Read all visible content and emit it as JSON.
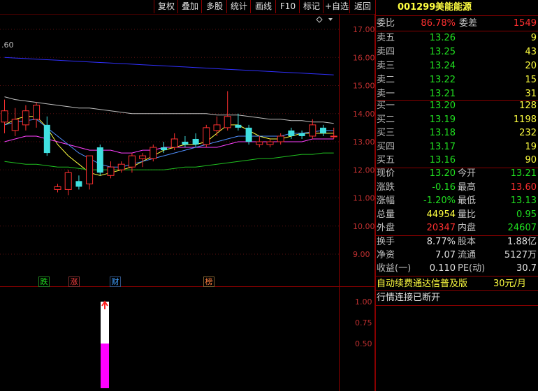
{
  "toolbar": {
    "buttons": [
      "复权",
      "叠加",
      "多股",
      "统计",
      "画线",
      "F10",
      "标记",
      "+自选",
      "返回"
    ]
  },
  "chart": {
    "price_axis": [
      "17.00",
      "16.00",
      "15.00",
      "14.00",
      "13.00",
      "12.00",
      "11.00",
      "10.00",
      "9.00"
    ],
    "indicator_axis": [
      "1.00",
      "0.75",
      "0.50"
    ],
    "left_label": ".60",
    "events": [
      "跌",
      "涨",
      "财",
      "榜"
    ],
    "indicator_value": 0.5
  },
  "chart_data": {
    "type": "candlestick",
    "ylim": [
      8.6,
      17.4
    ],
    "candles": [
      {
        "o": 13.7,
        "h": 14.5,
        "l": 13.3,
        "c": 14.1
      },
      {
        "o": 13.4,
        "h": 14.2,
        "l": 13.2,
        "c": 13.8
      },
      {
        "o": 13.6,
        "h": 14.3,
        "l": 13.4,
        "c": 14.1
      },
      {
        "o": 13.8,
        "h": 14.4,
        "l": 13.5,
        "c": 14.3
      },
      {
        "o": 13.6,
        "h": 13.9,
        "l": 12.5,
        "c": 12.6
      },
      {
        "o": 11.3,
        "h": 11.5,
        "l": 11.2,
        "c": 11.4
      },
      {
        "o": 11.3,
        "h": 12.0,
        "l": 11.1,
        "c": 11.9
      },
      {
        "o": 11.6,
        "h": 11.8,
        "l": 11.3,
        "c": 11.4
      },
      {
        "o": 11.5,
        "h": 12.5,
        "l": 11.3,
        "c": 12.5
      },
      {
        "o": 12.8,
        "h": 12.9,
        "l": 11.8,
        "c": 11.9
      },
      {
        "o": 11.8,
        "h": 12.3,
        "l": 11.7,
        "c": 12.1
      },
      {
        "o": 12.0,
        "h": 12.3,
        "l": 11.9,
        "c": 12.2
      },
      {
        "o": 12.1,
        "h": 12.6,
        "l": 11.9,
        "c": 12.5
      },
      {
        "o": 12.4,
        "h": 12.6,
        "l": 12.1,
        "c": 12.5
      },
      {
        "o": 12.4,
        "h": 12.9,
        "l": 12.3,
        "c": 12.8
      },
      {
        "o": 12.8,
        "h": 13.0,
        "l": 12.6,
        "c": 12.7
      },
      {
        "o": 12.8,
        "h": 13.3,
        "l": 12.7,
        "c": 13.1
      },
      {
        "o": 13.0,
        "h": 13.2,
        "l": 12.8,
        "c": 12.9
      },
      {
        "o": 13.1,
        "h": 13.3,
        "l": 12.8,
        "c": 12.9
      },
      {
        "o": 12.9,
        "h": 13.6,
        "l": 12.8,
        "c": 13.5
      },
      {
        "o": 13.4,
        "h": 13.9,
        "l": 13.2,
        "c": 13.6
      },
      {
        "o": 13.5,
        "h": 14.8,
        "l": 13.4,
        "c": 13.9
      },
      {
        "o": 13.6,
        "h": 14.0,
        "l": 13.4,
        "c": 13.5
      },
      {
        "o": 13.5,
        "h": 13.6,
        "l": 12.9,
        "c": 13.0
      },
      {
        "o": 12.9,
        "h": 13.2,
        "l": 12.8,
        "c": 13.0
      },
      {
        "o": 12.9,
        "h": 13.1,
        "l": 12.8,
        "c": 13.0
      },
      {
        "o": 13.0,
        "h": 13.3,
        "l": 12.9,
        "c": 13.2
      },
      {
        "o": 13.4,
        "h": 13.5,
        "l": 13.1,
        "c": 13.2
      },
      {
        "o": 13.3,
        "h": 13.4,
        "l": 13.1,
        "c": 13.2
      },
      {
        "o": 13.2,
        "h": 13.8,
        "l": 13.1,
        "c": 13.6
      },
      {
        "o": 13.5,
        "h": 13.6,
        "l": 13.2,
        "c": 13.3
      },
      {
        "o": 13.2,
        "h": 13.5,
        "l": 13.1,
        "c": 13.2
      }
    ],
    "ma_series": [
      {
        "color": "#3030ff",
        "values": [
          16.0,
          15.98,
          15.96,
          15.94,
          15.92,
          15.9,
          15.88,
          15.86,
          15.84,
          15.82,
          15.8,
          15.78,
          15.76,
          15.74,
          15.72,
          15.7,
          15.68,
          15.66,
          15.64,
          15.62,
          15.6,
          15.58,
          15.56,
          15.54,
          15.52,
          15.5,
          15.48,
          15.46,
          15.44,
          15.42,
          15.4,
          15.38
        ]
      },
      {
        "color": "#c0c0c0",
        "values": [
          14.6,
          14.5,
          14.45,
          14.4,
          14.35,
          14.3,
          14.25,
          14.2,
          14.2,
          14.15,
          14.1,
          14.05,
          14.0,
          14.0,
          14.0,
          14.0,
          14.0,
          14.0,
          14.0,
          14.0,
          13.95,
          13.95,
          13.95,
          13.9,
          13.85,
          13.8,
          13.8,
          13.75,
          13.75,
          13.7,
          13.7,
          13.65
        ]
      },
      {
        "color": "#ffff40",
        "values": [
          13.6,
          13.8,
          13.9,
          13.9,
          13.5,
          12.9,
          12.5,
          12.2,
          11.9,
          11.8,
          11.9,
          12.0,
          12.1,
          12.3,
          12.5,
          12.7,
          12.8,
          12.9,
          12.9,
          13.0,
          13.3,
          13.6,
          13.6,
          13.4,
          13.2,
          13.1,
          13.1,
          13.2,
          13.3,
          13.3,
          13.3,
          13.3
        ]
      },
      {
        "color": "#ff40ff",
        "values": [
          13.0,
          13.1,
          13.2,
          13.2,
          13.1,
          13.0,
          12.9,
          12.8,
          12.7,
          12.7,
          12.7,
          12.6,
          12.6,
          12.7,
          12.7,
          12.8,
          12.8,
          12.8,
          12.8,
          12.8,
          12.8,
          12.9,
          13.0,
          13.0,
          13.0,
          13.0,
          13.0,
          13.0,
          13.0,
          13.1,
          13.1,
          13.1
        ]
      },
      {
        "color": "#20c020",
        "values": [
          12.3,
          12.25,
          12.2,
          12.2,
          12.15,
          12.1,
          12.1,
          12.05,
          12.0,
          12.0,
          12.0,
          12.0,
          12.0,
          12.0,
          12.0,
          12.0,
          12.05,
          12.1,
          12.1,
          12.15,
          12.2,
          12.25,
          12.3,
          12.35,
          12.4,
          12.4,
          12.45,
          12.5,
          12.55,
          12.55,
          12.6,
          12.6
        ]
      },
      {
        "color": "#5090ff",
        "values": [
          13.6,
          13.7,
          13.75,
          13.8,
          13.5,
          13.2,
          12.9,
          12.6,
          12.4,
          12.2,
          12.1,
          12.1,
          12.2,
          12.3,
          12.4,
          12.5,
          12.6,
          12.7,
          12.8,
          12.9,
          13.0,
          13.1,
          13.2,
          13.2,
          13.2,
          13.2,
          13.2,
          13.3,
          13.3,
          13.35,
          13.4,
          13.4
        ]
      }
    ]
  },
  "stock": {
    "code": "001299",
    "name": "美能能源"
  },
  "weibi": {
    "label": "委比",
    "value": "86.78%",
    "diff_label": "委差",
    "diff_value": "1549"
  },
  "asks": [
    {
      "label": "卖五",
      "price": "13.26",
      "vol": "9"
    },
    {
      "label": "卖四",
      "price": "13.25",
      "vol": "43"
    },
    {
      "label": "卖三",
      "price": "13.24",
      "vol": "20"
    },
    {
      "label": "卖二",
      "price": "13.22",
      "vol": "15"
    },
    {
      "label": "卖一",
      "price": "13.21",
      "vol": "31"
    }
  ],
  "bids": [
    {
      "label": "买一",
      "price": "13.20",
      "vol": "128"
    },
    {
      "label": "买二",
      "price": "13.19",
      "vol": "1198"
    },
    {
      "label": "买三",
      "price": "13.18",
      "vol": "232"
    },
    {
      "label": "买四",
      "price": "13.17",
      "vol": "19"
    },
    {
      "label": "买五",
      "price": "13.16",
      "vol": "90"
    }
  ],
  "quote": [
    {
      "l1": "现价",
      "v1": "13.20",
      "c1": "green",
      "l2": "今开",
      "v2": "13.21",
      "c2": "green"
    },
    {
      "l1": "涨跌",
      "v1": "-0.16",
      "c1": "green",
      "l2": "最高",
      "v2": "13.60",
      "c2": "red"
    },
    {
      "l1": "涨幅",
      "v1": "-1.20%",
      "c1": "green",
      "l2": "最低",
      "v2": "13.13",
      "c2": "green"
    },
    {
      "l1": "总量",
      "v1": "44954",
      "c1": "yellow",
      "l2": "量比",
      "v2": "0.95",
      "c2": "green"
    },
    {
      "l1": "外盘",
      "v1": "20347",
      "c1": "red",
      "l2": "内盘",
      "v2": "24607",
      "c2": "green"
    }
  ],
  "fundamentals": [
    {
      "l1": "换手",
      "v1": "8.77%",
      "l2": "股本",
      "v2": "1.88亿"
    },
    {
      "l1": "净资",
      "v1": "7.07",
      "l2": "流通",
      "v2": "5127万"
    },
    {
      "l1": "收益(一)",
      "v1": "0.110",
      "l2": "PE(动)",
      "v2": "30.7"
    }
  ],
  "promo": {
    "text": "自动续费通达信普及版",
    "price": "30元/月"
  },
  "status": "行情连接已断开",
  "colors": {
    "up": "#ff3030",
    "down": "#40e0e0",
    "border": "#8a0000"
  }
}
